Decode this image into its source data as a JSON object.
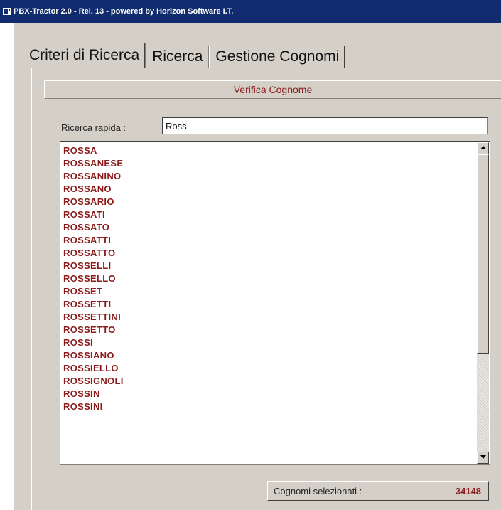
{
  "window": {
    "title": "PBX-Tractor 2.0 - Rel. 13 - powered by Horizon Software I.T."
  },
  "tabs": [
    {
      "label": "Criteri di Ricerca"
    },
    {
      "label": "Ricerca"
    },
    {
      "label": "Gestione Cognomi"
    }
  ],
  "section": {
    "title": "Verifica Cognome"
  },
  "search": {
    "label": "Ricerca rapida :",
    "value": "Ross"
  },
  "list": {
    "items": [
      "ROSSA",
      "ROSSANESE",
      "ROSSANINO",
      "ROSSANO",
      "ROSSARIO",
      "ROSSATI",
      "ROSSATO",
      "ROSSATTI",
      "ROSSATTO",
      "ROSSELLI",
      "ROSSELLO",
      "ROSSET",
      "ROSSETTI",
      "ROSSETTINI",
      "ROSSETTO",
      "ROSSI",
      "ROSSIANO",
      "ROSSIELLO",
      "ROSSIGNOLI",
      "ROSSIN",
      "ROSSINI"
    ]
  },
  "status": {
    "label": "Cognomi selezionati :",
    "count": "34148"
  },
  "colors": {
    "accent": "#8b1a1a",
    "titlebar": "#102c6e",
    "face": "#d4d0c8"
  }
}
